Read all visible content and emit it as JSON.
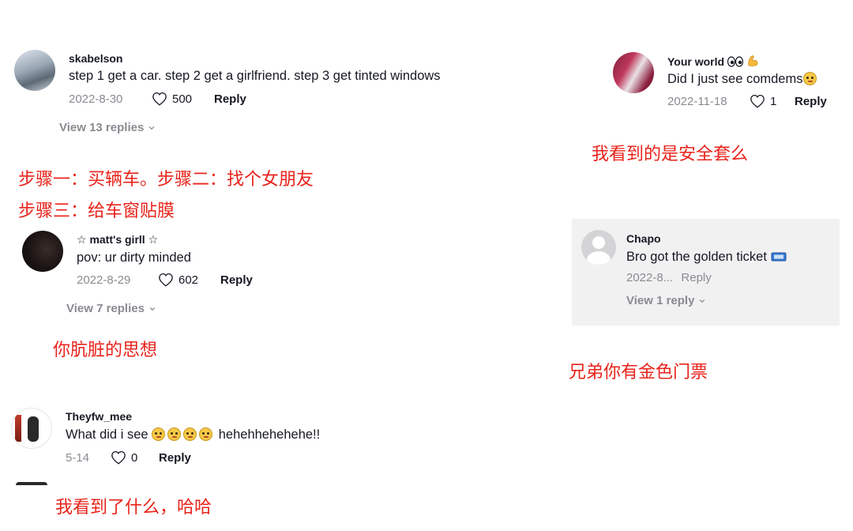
{
  "comments": [
    {
      "username": "skabelson",
      "text": "step 1 get a car. step 2 get a girlfriend. step 3 get tinted windows",
      "date": "2022-8-30",
      "likes": "500",
      "reply_label": "Reply",
      "view_replies": "View 13 replies",
      "translation_line1": "步骤一：买辆车。步骤二：找个女朋友",
      "translation_line2": "步骤三：给车窗贴膜"
    },
    {
      "username": "☆ matt's girll ☆",
      "text": "pov: ur dirty minded",
      "date": "2022-8-29",
      "likes": "602",
      "reply_label": "Reply",
      "view_replies": "View 7 replies",
      "translation": "你肮脏的思想"
    },
    {
      "username": "Theyfw_mee",
      "text_prefix": "What did i see",
      "text_suffix": "hehehhehehehe!!",
      "date": "5-14",
      "likes": "0",
      "reply_label": "Reply",
      "translation": "我看到了什么，哈哈"
    },
    {
      "username": "Your world",
      "text": "Did I just see comdems",
      "date": "2022-11-18",
      "likes": "1",
      "reply_label": "Reply",
      "translation": "我看到的是安全套么"
    },
    {
      "username": "Chapo",
      "text": "Bro got the golden ticket",
      "date": "2022-8...",
      "reply_label": "Reply",
      "view_replies": "View 1 reply",
      "translation": "兄弟你有金色门票"
    }
  ],
  "colors": {
    "translation": "#e8231b",
    "meta": "#8a8b91",
    "text": "#161823",
    "card_bg": "#f1f1f2"
  },
  "icons": [
    "heart-outline-icon",
    "chevron-down-icon",
    "emoji-face-icon",
    "eyes-icon",
    "flexed-biceps-icon",
    "ticket-icon"
  ]
}
